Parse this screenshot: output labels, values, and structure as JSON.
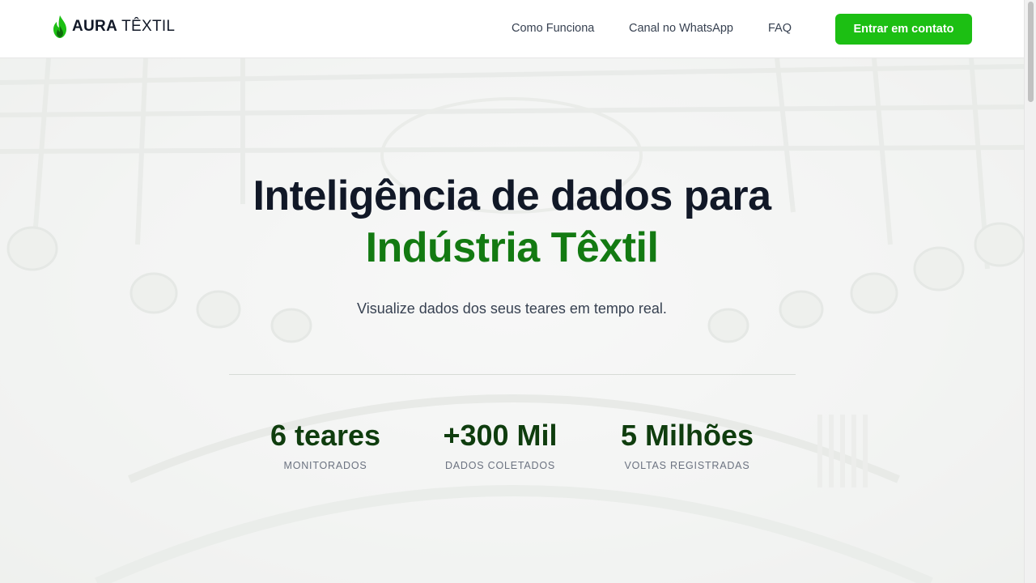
{
  "brand": {
    "name_bold": "AURA",
    "name_light": "TÊXTIL",
    "accent": "#1cbf13"
  },
  "nav": [
    {
      "label": "Como Funciona"
    },
    {
      "label": "Canal no WhatsApp"
    },
    {
      "label": "FAQ"
    }
  ],
  "cta": {
    "label": "Entrar em contato"
  },
  "hero": {
    "title_line1": "Inteligência de dados para",
    "title_line2": "Indústria Têxtil",
    "subtitle": "Visualize dados dos seus teares em tempo real."
  },
  "stats": [
    {
      "value": "6 teares",
      "label": "MONITORADOS"
    },
    {
      "value": "+300 Mil",
      "label": "DADOS COLETADOS"
    },
    {
      "value": "5 Milhões",
      "label": "VOLTAS REGISTRADAS"
    }
  ]
}
